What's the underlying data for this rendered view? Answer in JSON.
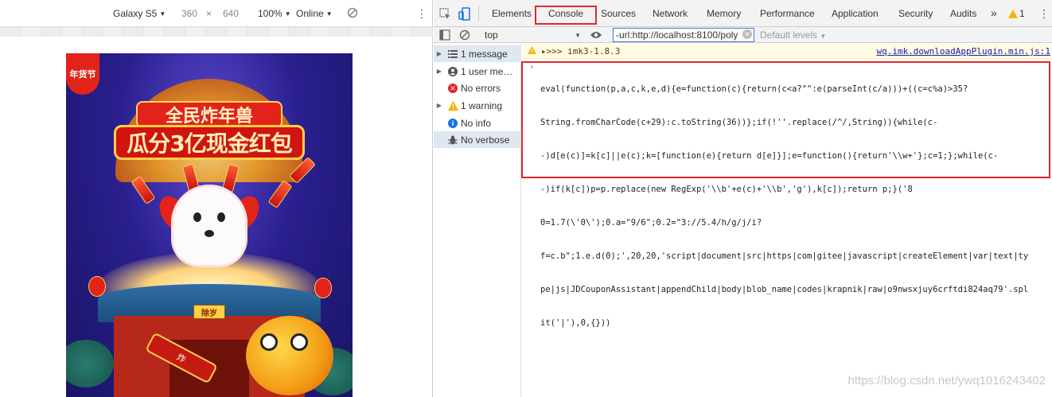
{
  "device_toolbar": {
    "device": "Galaxy S5",
    "width": "360",
    "times": "×",
    "height": "640",
    "zoom": "100%",
    "network": "Online"
  },
  "phone_content": {
    "logo_text": "年货节",
    "title_line1": "全民炸年兽",
    "title_line2": "瓜分3亿现金红包",
    "plaque": "除岁",
    "scroll": "炸"
  },
  "devtools": {
    "tabs": [
      "Elements",
      "Console",
      "Sources",
      "Network",
      "Memory",
      "Performance",
      "Application",
      "Security",
      "Audits"
    ],
    "active_tab": "Console",
    "more": "»",
    "warning_count": "1",
    "context": "top",
    "filter_value": "-url:http://localhost:8100/poly",
    "levels": "Default levels"
  },
  "sidebar": {
    "items": [
      {
        "label": "1 message",
        "icon": "list-icon"
      },
      {
        "label": "1 user mes...",
        "icon": "user-icon"
      },
      {
        "label": "No errors",
        "icon": "error-icon"
      },
      {
        "label": "1 warning",
        "icon": "warning-icon"
      },
      {
        "label": "No info",
        "icon": "info-icon"
      },
      {
        "label": "No verbose",
        "icon": "bug-icon"
      }
    ]
  },
  "console": {
    "warning_text": "▸>>> imk3-1.8.3",
    "warning_source": "wq.imk.downloadAppPlugin.min.js:1",
    "code_lines": [
      "eval(function(p,a,c,k,e,d){e=function(c){return(c<a?\"\":e(parseInt(c/a)))+((c=c%a)>35?",
      "String.fromCharCode(c+29):c.toString(36))};if(!''.replace(/^/,String)){while(c-",
      "-)d[e(c)]=k[c]||e(c);k=[function(e){return d[e]}];e=function(){return'\\\\w+'};c=1;};while(c-",
      "-)if(k[c])p=p.replace(new RegExp('\\\\b'+e(c)+'\\\\b','g'),k[c]);return p;}('8",
      "0=1.7(\\'0\\');0.a=\"9/6\";0.2=\"3://5.4/h/g/j/i?",
      "f=c.b\";1.e.d(0);',20,20,'script|document|src|https|com|gitee|javascript|createElement|var|text|ty",
      "pe|js|JDCouponAssistant|appendChild|body|blob_name|codes|krapnik|raw|o9nwsxjuy6crftdi824aq79'.spl",
      "it('|'),0,{}))"
    ]
  },
  "watermark": "https://blog.csdn.net/ywq1016243402"
}
